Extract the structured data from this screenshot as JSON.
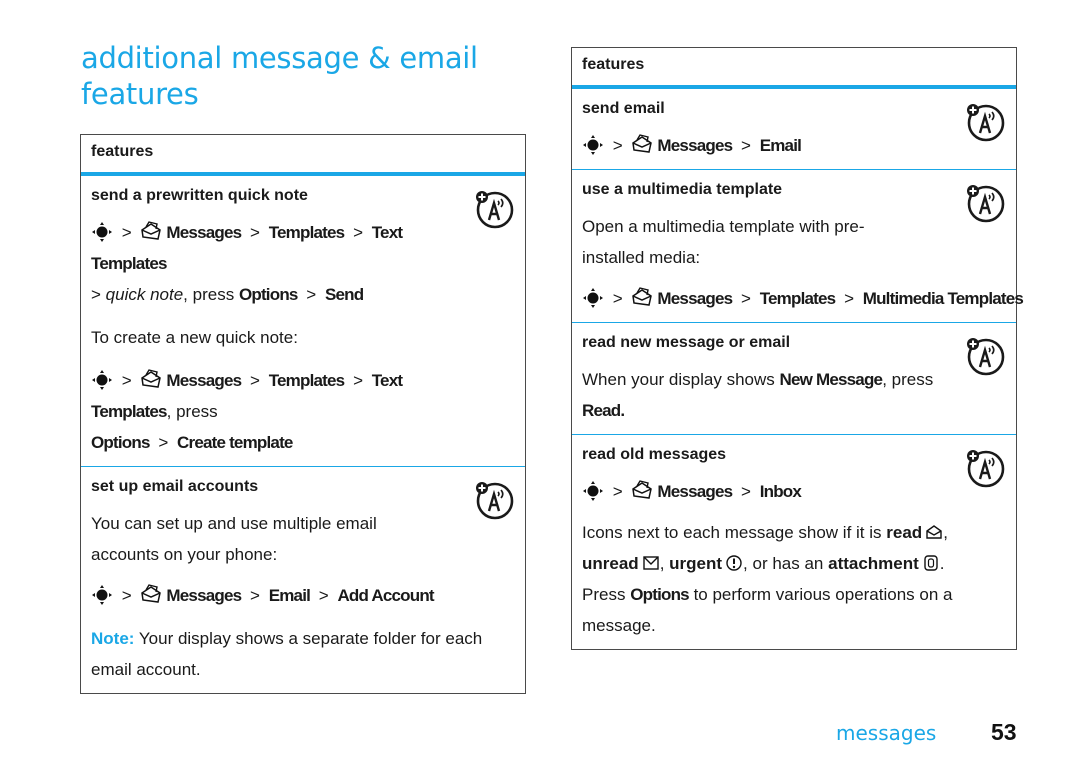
{
  "page": {
    "title": "additional message & email features",
    "footer_section": "messages",
    "page_number": "53",
    "accent_color": "#1aa7e6"
  },
  "left_table": {
    "header": "features",
    "rows": [
      {
        "title": "send a prewritten quick note",
        "icon": "network-feature-icon",
        "path1": {
          "items": [
            "Messages",
            "Templates",
            "Text Templates"
          ]
        },
        "path1_cont": {
          "prefix": ">",
          "italic": "quick note",
          "mid": ", press",
          "items": [
            "Options",
            "Send"
          ]
        },
        "text": "To create a new quick note:",
        "path2": {
          "items": [
            "Messages",
            "Templates",
            "Text Templates"
          ],
          "suffix": ", press"
        },
        "path2_cont": {
          "items": [
            "Options",
            "Create template"
          ]
        }
      },
      {
        "title": "set up email accounts",
        "icon": "network-feature-icon",
        "text": "You can set up and use multiple email accounts on your phone:",
        "path": {
          "items": [
            "Messages",
            "Email",
            "Add Account"
          ]
        },
        "note_label": "Note:",
        "note_text": "Your display shows a separate folder for each email account."
      }
    ]
  },
  "right_table": {
    "header": "features",
    "rows": [
      {
        "title": "send email",
        "icon": "network-feature-icon",
        "path": {
          "items": [
            "Messages",
            "Email"
          ]
        }
      },
      {
        "title": "use a multimedia template",
        "icon": "network-feature-icon",
        "text": "Open a multimedia template with pre-installed media:",
        "path": {
          "items": [
            "Messages",
            "Templates",
            "Multimedia Templates"
          ]
        }
      },
      {
        "title": "read new message or email",
        "icon": "network-feature-icon",
        "text_pre": "When your display shows",
        "text_key": "New Message",
        "text_mid": ", press",
        "text_key2": "Read",
        "text_end": "."
      },
      {
        "title": "read old messages",
        "icon": "network-feature-icon",
        "path": {
          "items": [
            "Messages",
            "Inbox"
          ]
        },
        "t1": "Icons next to each message show if it is",
        "read_label": "read",
        "unread_label": "unread",
        "urgent_label": "urgent",
        "t2": ", or has an",
        "attachment_label": "attachment",
        "t3": "Press",
        "options_key": "Options",
        "t4": "to perform various operations on a message.",
        "comma": ",",
        "period": "."
      }
    ]
  },
  "symbols": {
    "separator": ">",
    "nav_key_icon": "navigation-key-icon",
    "messages_icon": "messages-envelope-icon"
  }
}
